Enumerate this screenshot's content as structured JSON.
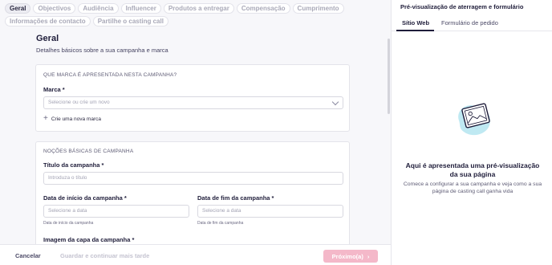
{
  "tabs": [
    {
      "label": "Geral"
    },
    {
      "label": "Objectivos"
    },
    {
      "label": "Audiência"
    },
    {
      "label": "Influencer"
    },
    {
      "label": "Produtos a entregar"
    },
    {
      "label": "Compensação"
    },
    {
      "label": "Cumprimento"
    },
    {
      "label": "Informações de contacto"
    },
    {
      "label": "Partilhe o casting call"
    }
  ],
  "header": {
    "title": "Geral",
    "subtitle": "Detalhes básicos sobre a sua campanha e marca"
  },
  "brand_section": {
    "title": "QUE MARCA É APRESENTADA NESTA CAMPANHA?",
    "brand_label": "Marca *",
    "brand_placeholder": "Selecione ou crie um novo",
    "create_brand": "Crie uma nova marca"
  },
  "basics_section": {
    "title": "NOÇÕES BÁSICAS DE CAMPANHA",
    "campaign_title_label": "Título da campanha *",
    "campaign_title_placeholder": "Introduza o título",
    "start_date_label": "Data de início da campanha *",
    "start_date_placeholder": "Selecione a data",
    "start_date_hint": "Data de início da campanha",
    "end_date_label": "Data de fim da campanha *",
    "end_date_placeholder": "Selecione a data",
    "end_date_hint": "Data de fim da campanha",
    "cover_image_label": "Imagem da capa da campanha *"
  },
  "footer": {
    "cancel": "Cancelar",
    "save_later": "Guardar e continuar mais tarde",
    "next": "Próximo(a)"
  },
  "preview": {
    "title": "Pré-visualização de aterragem e formulário",
    "tab_web": "Sítio Web",
    "tab_form": "Formulário de pedido",
    "empty_title": "Aqui é apresentada uma pré-visualização da sua página",
    "empty_text": "Comece a configurar a sua campanha e veja como a sua página de casting call ganha vida"
  },
  "colors": {
    "next_button": "#f4b8c9",
    "illustration_blob": "#bfe9f2"
  }
}
